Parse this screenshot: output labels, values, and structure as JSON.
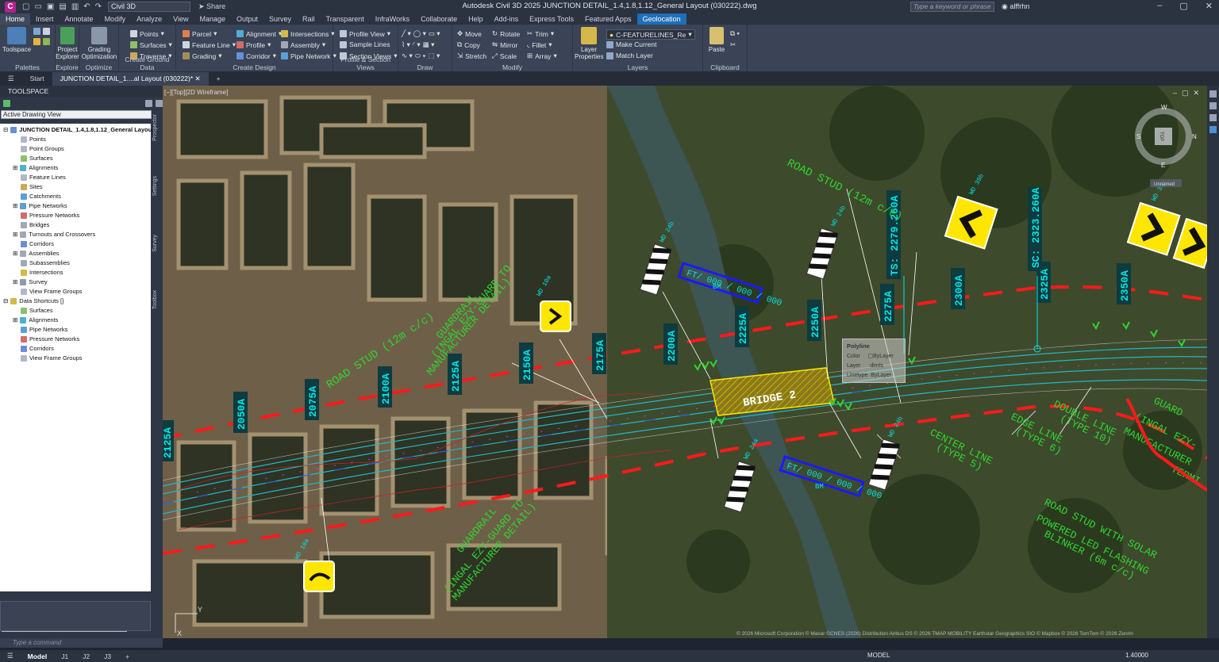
{
  "app": {
    "icon_letter": "C",
    "workspace": "Civil 3D",
    "share_label": "Share",
    "title": "Autodesk Civil 3D 2025   JUNCTION DETAIL_1.4,1.8,1.12_General Layout (030222).dwg",
    "search_placeholder": "Type a keyword or phrase",
    "user": "alffrhn"
  },
  "ribbon_tabs": [
    "Home",
    "Insert",
    "Annotate",
    "Modify",
    "Analyze",
    "View",
    "Manage",
    "Output",
    "Survey",
    "Rail",
    "Transparent",
    "InfraWorks",
    "Collaborate",
    "Help",
    "Add-ins",
    "Express Tools",
    "Featured Apps",
    "Geolocation"
  ],
  "ribbon": {
    "palettes": {
      "title": "Palettes",
      "toolspace": "Toolspace"
    },
    "explore": {
      "title": "Explore",
      "project_explorer": "Project Explorer"
    },
    "optimize": {
      "title": "Optimize",
      "grading_optimization": "Grading Optimization"
    },
    "ground": {
      "title": "Create Ground Data",
      "points": "Points",
      "surfaces": "Surfaces",
      "traverse": "Traverse"
    },
    "design": {
      "title": "Create Design",
      "parcel": "Parcel",
      "feature_line": "Feature Line",
      "grading": "Grading",
      "alignment": "Alignment",
      "profile": "Profile",
      "corridor": "Corridor",
      "intersections": "Intersections",
      "assembly": "Assembly",
      "pipe_network": "Pipe Network"
    },
    "profile": {
      "title": "Profile & Section Views",
      "profile_view": "Profile View",
      "sample_lines": "Sample Lines",
      "section_views": "Section Views"
    },
    "draw": {
      "title": "Draw"
    },
    "modify": {
      "title": "Modify",
      "move": "Move",
      "copy": "Copy",
      "stretch": "Stretch",
      "rotate": "Rotate",
      "mirror": "Mirror",
      "scale": "Scale",
      "trim": "Trim",
      "fillet": "Fillet",
      "array": "Array"
    },
    "layers": {
      "title": "Layers",
      "layer_properties": "Layer Properties",
      "current_layer": "C-FEATURELINES_Re",
      "make_current": "Make Current",
      "match_layer": "Match Layer"
    },
    "clipboard": {
      "title": "Clipboard",
      "paste": "Paste"
    }
  },
  "doc_tabs": {
    "start": "Start",
    "active": "JUNCTION DETAIL_1....al Layout (030222)*",
    "add": "+"
  },
  "toolspace": {
    "title": "TOOLSPACE",
    "view_select": "Active Drawing View",
    "tree": [
      "JUNCTION DETAIL_1.4,1.8,1.12_General Layou...",
      "Points",
      "Point Groups",
      "Surfaces",
      "Alignments",
      "Feature Lines",
      "Sites",
      "Catchments",
      "Pipe Networks",
      "Pressure Networks",
      "Bridges",
      "Turnouts and Crossovers",
      "Corridors",
      "Assemblies",
      "Subassemblies",
      "Intersections",
      "Survey",
      "View Frame Groups",
      "Data Shortcuts []",
      "Surfaces",
      "Alignments",
      "Pipe Networks",
      "Pressure Networks",
      "Corridors",
      "View Frame Groups"
    ],
    "side_tabs": [
      "Prospector",
      "Settings",
      "Survey",
      "Toolbox"
    ],
    "command_placeholder": "Type a command"
  },
  "viewport": {
    "label": "[−][Top][2D Wireframe]",
    "view_cube": {
      "top": "TOP",
      "n": "N",
      "s": "S",
      "e": "E",
      "w": "W",
      "ucs": "Unnamed"
    },
    "ucs_y": "Y",
    "ucs_x": "X",
    "copyright": "© 2026 Microsoft Corporation © Maxar ©CNES (2026) Distribution Airbus DS © 2026 TMAP MOBILITY Earthstar Geographics  SIO © Mapbox © 2026 TomTom © 2026 Zenrin",
    "tooltip": {
      "title": "Polyline",
      "color_label": "Color",
      "color_value": "ByLayer",
      "layer_label": "Layer",
      "layer_value": "dimts",
      "linetype_label": "Linetype",
      "linetype_value": "ByLayer"
    },
    "annotations": {
      "chainages": [
        "2125A",
        "2050A",
        "2075A",
        "2100A",
        "2125A",
        "2150A",
        "2175A",
        "2200A",
        "2225A",
        "2250A",
        "2275A",
        "2300A",
        "2325A",
        "2350A"
      ],
      "ts": "TS: 2279.260A",
      "sc": "SC: 2323.260A",
      "bridge": "BRIDGE 2",
      "bm_box": "FT/ 000 / 000 / 000",
      "bm": "BM",
      "road_stud_1": "ROAD STUD (12m c/c)",
      "road_stud_2": "ROAD STUD (12m c/c)",
      "guardrail_1a": "GUARDRAIL",
      "guardrail_1b": "(INGAL EZY-GUARD TO",
      "guardrail_1c": "MANUFACTURER DETAIL)",
      "guardrail_2a": "GUARDRAIL",
      "guardrail_2b": "(INGAL EZY-GUARD TO",
      "guardrail_2c": "MANUFACTURER DETAIL)",
      "guard_right_a": "GUARD",
      "guard_right_b": "(INGAL EZY-",
      "guard_right_c": "MANUFACTURER",
      "termi": "TERMI",
      "center_line_a": "CENTER LINE",
      "center_line_b": "(TYPE 5)",
      "edge_line_a": "EDGE LINE",
      "edge_line_b": "(TYPE 6)",
      "double_line_a": "DOUBLE LINE",
      "double_line_b": "(TYPE 10)",
      "solar_a": "ROAD STUD WITH SOLAR",
      "solar_b": "POWERED LED FLASHING",
      "solar_c": "BLINKER (6m c/c)",
      "wd24b": "WD 24b",
      "wd10a": "WD 10a",
      "wd39b": "WD 39b",
      "wd39a": "WD 39a",
      "wd24a": "WD 24a"
    }
  },
  "status": {
    "layouts": [
      "Model",
      "J1",
      "J2",
      "J3"
    ],
    "add": "+",
    "model": "MODEL",
    "scale": "1.40000"
  },
  "colors": {
    "chainage_bg": "#0d3b3f",
    "chainage_text": "#00e6e6",
    "label_green": "#2fd62f",
    "alignment_cyan": "#33ccdd",
    "guardrail_red": "#ff1a1a",
    "sign_yellow": "#ffe600"
  }
}
